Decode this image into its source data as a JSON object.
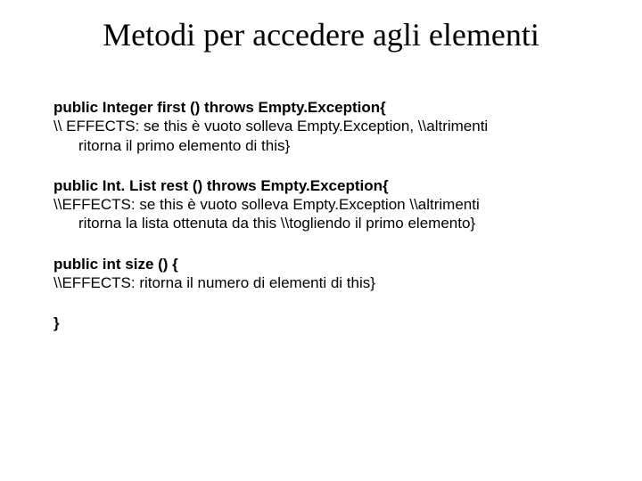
{
  "title": "Metodi per accedere agli elementi",
  "blocks": {
    "b1": {
      "sig": "public  Integer first () throws Empty.Exception{",
      "c1": " \\\\ EFFECTS: se this è vuoto solleva Empty.Exception, \\\\altrimenti",
      "c2": "ritorna il primo elemento di this}"
    },
    "b2": {
      "sig": "public  Int. List rest () throws Empty.Exception{",
      "c1": " \\\\EFFECTS: se this è vuoto solleva Empty.Exception \\\\altrimenti",
      "c2": "ritorna la lista ottenuta da this \\\\togliendo il primo elemento}"
    },
    "b3": {
      "sig": "public  int size () {",
      "c1": "  \\\\EFFECTS: ritorna il numero di elementi di this}"
    },
    "close": "}"
  }
}
